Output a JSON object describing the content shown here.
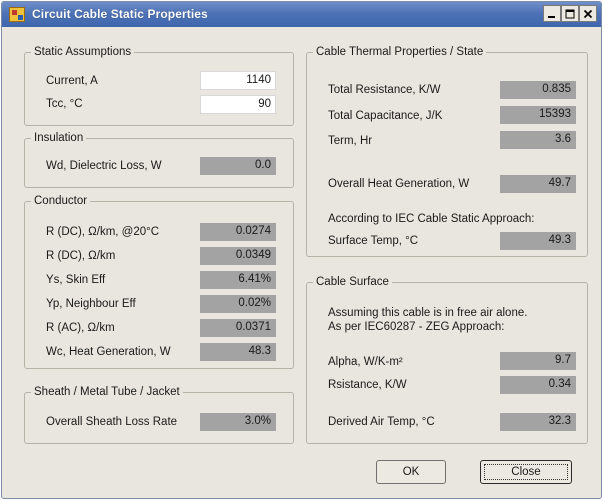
{
  "window": {
    "title": "Circuit Cable Static Properties",
    "icon": "app-icon",
    "controls": {
      "minimize": "minimize-icon",
      "maximize": "maximize-icon",
      "close": "close-icon"
    }
  },
  "static_assumptions": {
    "title": "Static Assumptions",
    "current_label": "Current, A",
    "current_value": "1140",
    "tcc_label": "Tcc, °C",
    "tcc_value": "90"
  },
  "insulation": {
    "title": "Insulation",
    "wd_label": "Wd, Dielectric Loss, W",
    "wd_value": "0.0"
  },
  "conductor": {
    "title": "Conductor",
    "rows": [
      {
        "label": "R (DC), Ω/km, @20°C",
        "value": "0.0274"
      },
      {
        "label": "R (DC), Ω/km",
        "value": "0.0349"
      },
      {
        "label": "Ys, Skin Eff",
        "value": "6.41%"
      },
      {
        "label": "Yp, Neighbour Eff",
        "value": "0.02%"
      },
      {
        "label": "R (AC), Ω/km",
        "value": "0.0371"
      },
      {
        "label": "Wc, Heat Generation, W",
        "value": "48.3"
      }
    ]
  },
  "sheath": {
    "title": "Sheath / Metal Tube / Jacket",
    "loss_label": "Overall Sheath Loss Rate",
    "loss_value": "3.0%"
  },
  "thermal": {
    "title": "Cable Thermal Properties / State",
    "resistance_label": "Total Resistance, K/W",
    "resistance_value": "0.835",
    "capacitance_label": "Total Capacitance, J/K",
    "capacitance_value": "15393",
    "term_label": "Term, Hr",
    "term_value": "3.6",
    "heat_label": "Overall Heat Generation, W",
    "heat_value": "49.7",
    "iec_note": "According to IEC Cable Static Approach:",
    "surface_label": "Surface Temp, °C",
    "surface_value": "49.3"
  },
  "surface": {
    "title": "Cable Surface",
    "note_line1": "Assuming this cable is in free air alone.",
    "note_line2": "As per IEC60287 - ZEG Approach:",
    "alpha_label": "Alpha, W/K-m²",
    "alpha_value": "9.7",
    "rsistance_label": "Rsistance, K/W",
    "rsistance_value": "0.34",
    "air_label": "Derived Air Temp, °C",
    "air_value": "32.3"
  },
  "buttons": {
    "ok": "OK",
    "close": "Close"
  }
}
